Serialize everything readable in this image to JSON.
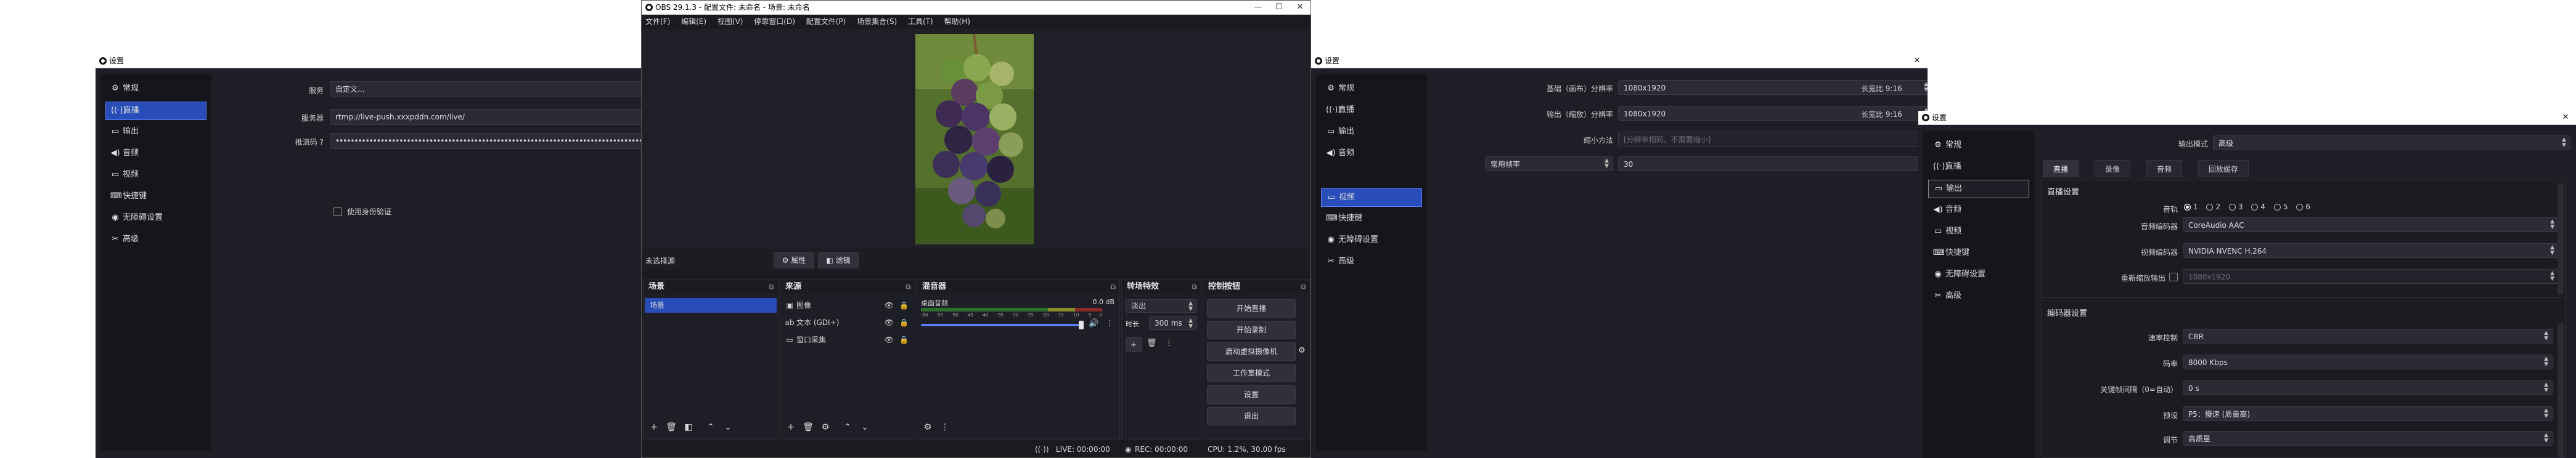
{
  "win1": {
    "title": "设置",
    "sidebar": [
      {
        "icon": "⚙",
        "label": "常规"
      },
      {
        "icon": "((·))",
        "label": "直播"
      },
      {
        "icon": "▭",
        "label": "输出"
      },
      {
        "icon": "◀)",
        "label": "音频"
      },
      {
        "icon": "▭",
        "label": "视频"
      },
      {
        "icon": "⌨",
        "label": "快捷键"
      },
      {
        "icon": "◉",
        "label": "无障碍设置"
      },
      {
        "icon": "✂",
        "label": "高级"
      }
    ],
    "service_label": "服务",
    "service_value": "自定义...",
    "server_label": "服务器",
    "server_value": "rtmp://live-push.xxxpddn.com/live/",
    "key_label": "推流码",
    "key_value": "••••••••••••••••••••••••••••••••••••••••••••••••••••••••••••••••••••••••••••••••••••••••••••••••••••••••••••••",
    "auth_label": "使用身份验证"
  },
  "obs": {
    "title": "OBS 29.1.3 - 配置文件: 未命名 - 场景: 未命名",
    "menu": [
      "文件(F)",
      "编辑(E)",
      "视图(V)",
      "停靠窗口(D)",
      "配置文件(P)",
      "场景集合(S)",
      "工具(T)",
      "帮助(H)"
    ],
    "source_toolbar": {
      "no_source": "未选择源",
      "properties": "属性",
      "filters": "滤镜"
    },
    "scenes": {
      "title": "场景",
      "items": [
        "场景"
      ]
    },
    "sources": {
      "title": "来源",
      "items": [
        {
          "icon": "🖼",
          "label": "图像"
        },
        {
          "icon": "ab",
          "label": "文本 (GDI+)"
        },
        {
          "icon": "▭",
          "label": "窗口采集"
        }
      ]
    },
    "mixer": {
      "title": "混音器",
      "channel": "桌面音频",
      "level": "0.0 dB",
      "ticks": [
        "-60",
        "-55",
        "-50",
        "-45",
        "-40",
        "-35",
        "-30",
        "-25",
        "-20",
        "-15",
        "-10",
        "-5",
        "0"
      ]
    },
    "transitions": {
      "title": "转场特效",
      "type": "淡出",
      "duration_label": "时长",
      "duration": "300 ms"
    },
    "controls": {
      "title": "控制按钮",
      "buttons": [
        "开始直播",
        "开始录制",
        "启动虚拟摄像机",
        "工作室模式",
        "设置",
        "退出"
      ]
    },
    "status": {
      "live": "LIVE: 00:00:00",
      "rec": "REC: 00:00:00",
      "cpu": "CPU: 1.2%, 30.00 fps"
    }
  },
  "win2": {
    "title": "设置",
    "sidebar": [
      {
        "icon": "⚙",
        "label": "常规"
      },
      {
        "icon": "((·))",
        "label": "直播"
      },
      {
        "icon": "▭",
        "label": "输出"
      },
      {
        "icon": "◀)",
        "label": "音频"
      },
      {
        "icon": "▭",
        "label": "视频"
      },
      {
        "icon": "⌨",
        "label": "快捷键"
      },
      {
        "icon": "◉",
        "label": "无障碍设置"
      },
      {
        "icon": "✂",
        "label": "高级"
      }
    ],
    "base_label": "基础（画布）分辨率",
    "base_value": "1080x1920",
    "base_ratio": "长宽比 9:16",
    "output_label": "输出（缩放）分辨率",
    "output_value": "1080x1920",
    "output_ratio": "长宽比 9:16",
    "filter_label": "缩小方法",
    "filter_value": "[分辨率相同，不需要缩小]",
    "fps_type": "常用帧率",
    "fps_value": "30"
  },
  "win3": {
    "title": "设置",
    "sidebar": [
      {
        "icon": "⚙",
        "label": "常规"
      },
      {
        "icon": "((·))",
        "label": "直播"
      },
      {
        "icon": "▭",
        "label": "输出"
      },
      {
        "icon": "◀)",
        "label": "音频"
      },
      {
        "icon": "▭",
        "label": "视频"
      },
      {
        "icon": "⌨",
        "label": "快捷键"
      },
      {
        "icon": "◉",
        "label": "无障碍设置"
      },
      {
        "icon": "✂",
        "label": "高级"
      }
    ],
    "output_mode_label": "输出模式",
    "output_mode_value": "高级",
    "tabs": [
      "直播",
      "录像",
      "音频",
      "回放缓存"
    ],
    "live_settings": "直播设置",
    "audio_track_label": "音轨",
    "tracks": [
      "1",
      "2",
      "3",
      "4",
      "5",
      "6"
    ],
    "audio_encoder_label": "音频编码器",
    "audio_encoder_value": "CoreAudio AAC",
    "video_encoder_label": "视频编码器",
    "video_encoder_value": "NVIDIA NVENC H.264",
    "rescale_label": "重新缩放输出",
    "rescale_value": "1080x1920",
    "encoder_settings": "编码器设置",
    "rate_control_label": "速率控制",
    "rate_control_value": "CBR",
    "bitrate_label": "码率",
    "bitrate_value": "8000 Kbps",
    "keyframe_label": "关键帧间隔（0=自动）",
    "keyframe_value": "0 s",
    "preset_label": "预设",
    "preset_value": "P5：慢速 (质量高)",
    "tuning_label": "调节",
    "tuning_value": "高质量"
  }
}
